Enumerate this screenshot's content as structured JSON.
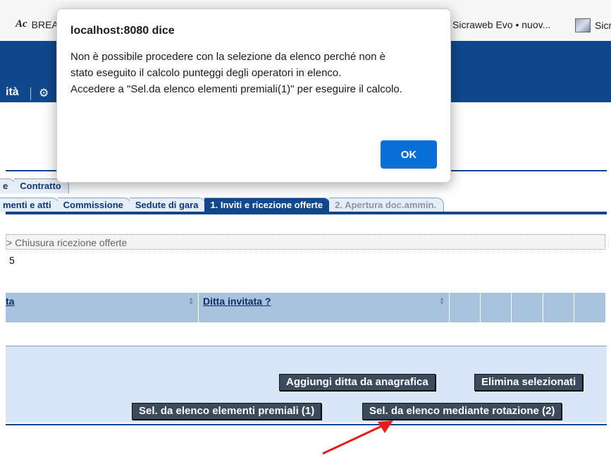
{
  "bookmarks": {
    "first_icon": "Ac",
    "first_label": "BREA",
    "second_label": "Sicraweb Evo • nuov...",
    "third_label": "Sicr"
  },
  "app_menu": {
    "label": "ità",
    "gear_icon": "⚙"
  },
  "tabs_row1": [
    {
      "label": "e"
    },
    {
      "label": "Contratto"
    }
  ],
  "tabs_row2": [
    {
      "label": "menti e atti"
    },
    {
      "label": "Commissione"
    },
    {
      "label": "Sedute di gara"
    },
    {
      "label": "1. Inviti e ricezione offerte"
    },
    {
      "label": "2. Apertura doc.ammin."
    }
  ],
  "breadcrumb": "> Chiusura ricezione offerte",
  "count": "5",
  "table": {
    "columns": [
      {
        "label": "ta"
      },
      {
        "label": "Ditta invitata ?"
      }
    ]
  },
  "buttons": {
    "add_from_registry": "Aggiungi ditta da anagrafica",
    "delete_selected": "Elimina selezionati",
    "select_premium": "Sel. da elenco elementi premiali (1)",
    "select_rotation": "Sel. da elenco mediante rotazione (2)"
  },
  "dialog": {
    "title": "localhost:8080 dice",
    "lines": [
      "Non è possibile procedere con la selezione da elenco perché non è",
      "stato eseguito il calcolo punteggi degli operatori in elenco.",
      "Accedere a \"Sel.da elenco elementi premiali(1)\" per eseguire il calcolo."
    ],
    "ok_label": "OK"
  },
  "colors": {
    "header_blue": "#11488d",
    "ok_blue": "#0a6fd6",
    "arrow_red": "#e81c1c"
  }
}
